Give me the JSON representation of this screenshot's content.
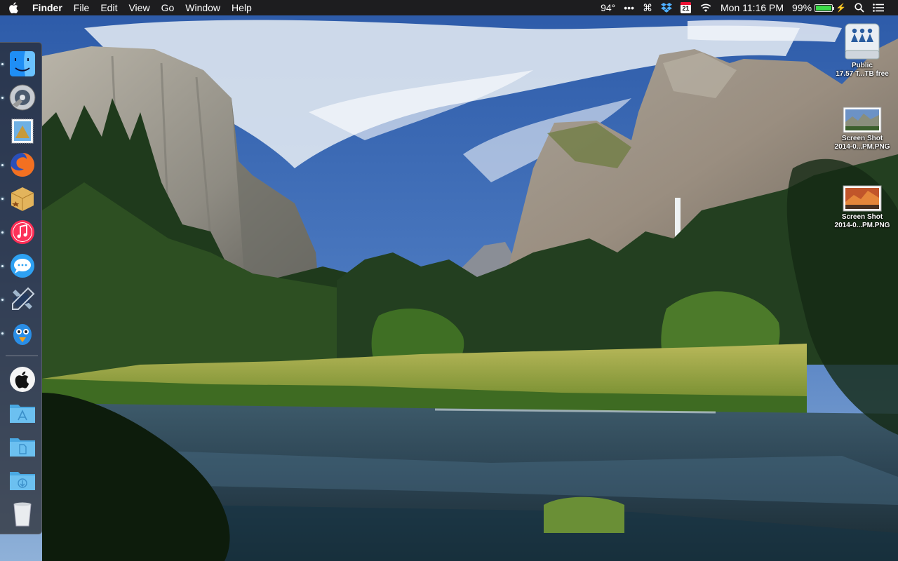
{
  "menubar": {
    "app_name": "Finder",
    "menus": [
      "File",
      "Edit",
      "View",
      "Go",
      "Window",
      "Help"
    ],
    "status": {
      "temperature": "94°",
      "more": "•••",
      "calendar_day": "21",
      "clock": "Mon 11:16 PM",
      "battery_percent": "99%",
      "battery_level": 0.99
    }
  },
  "dock": {
    "items": [
      {
        "name": "finder-icon",
        "running": true
      },
      {
        "name": "disk-utility-icon",
        "running": true
      },
      {
        "name": "mail-icon",
        "running": false
      },
      {
        "name": "firefox-icon",
        "running": true
      },
      {
        "name": "package-icon",
        "running": true
      },
      {
        "name": "itunes-icon",
        "running": true
      },
      {
        "name": "messages-icon",
        "running": true
      },
      {
        "name": "xcode-icon",
        "running": true
      },
      {
        "name": "tweetbot-icon",
        "running": true
      }
    ],
    "folders": [
      {
        "name": "apple-folder-icon"
      },
      {
        "name": "applications-folder-icon"
      },
      {
        "name": "documents-folder-icon"
      },
      {
        "name": "downloads-folder-icon"
      },
      {
        "name": "trash-icon"
      }
    ]
  },
  "desktop_icons": [
    {
      "type": "drive",
      "label_line1": "Public",
      "label_line2": "17.57 T...TB free"
    },
    {
      "type": "screenshot",
      "label_line1": "Screen Shot",
      "label_line2": "2014-0...PM.PNG"
    },
    {
      "type": "screenshot",
      "label_line1": "Screen Shot",
      "label_line2": "2014-0...PM.PNG"
    }
  ],
  "colors": {
    "menubar_bg": "#1d1d1f",
    "sky": "#3b68b0",
    "battery_fill": "#3ddc4a"
  }
}
